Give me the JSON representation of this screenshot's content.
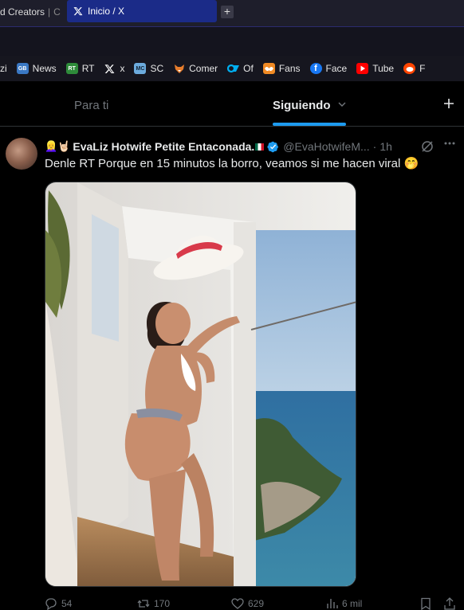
{
  "browser": {
    "prev_tab_label": "d Creators",
    "prev_tab_fragment": "C",
    "active_tab_title": "Inicio / X",
    "new_tab_symbol": "+"
  },
  "bookmarks": [
    {
      "label": "zi",
      "icon": "none",
      "color": ""
    },
    {
      "label": "News",
      "icon": "gb-news-icon",
      "color": "#3a78c4"
    },
    {
      "label": "RT",
      "icon": "rt-icon",
      "color": "#2e8b3a"
    },
    {
      "label": "x",
      "icon": "x-logo-icon",
      "color": "#000000"
    },
    {
      "label": "SC",
      "icon": "man-city-icon",
      "color": "#6cabdd"
    },
    {
      "label": "Comer",
      "icon": "fox-icon",
      "color": "#e87d2c"
    },
    {
      "label": "Of",
      "icon": "onlyfans-icon",
      "color": "#00aff0"
    },
    {
      "label": "Fans",
      "icon": "fansly-icon",
      "color": "#f08a24"
    },
    {
      "label": "Face",
      "icon": "facebook-icon",
      "color": "#1877f2"
    },
    {
      "label": "Tube",
      "icon": "youtube-icon",
      "color": "#ff0000"
    },
    {
      "label": "F",
      "icon": "reddit-icon",
      "color": "#ff4500"
    }
  ],
  "x": {
    "tab_for_you": "Para ti",
    "tab_following": "Siguiendo",
    "accent": "#1d9bf0"
  },
  "tweet": {
    "author_emojis": "👱‍♀️🤘🏻",
    "author_name": "EvaLiz Hotwife Petite Entaconada.",
    "handle": "@EvaHotwifeM...",
    "separator": "·",
    "time": "1h",
    "text": "Denle RT Porque en 15 minutos la borro, veamos si me hacen viral",
    "text_emoji": "🤭",
    "replies": "54",
    "reposts": "170",
    "likes": "629",
    "views": "6 mil"
  }
}
